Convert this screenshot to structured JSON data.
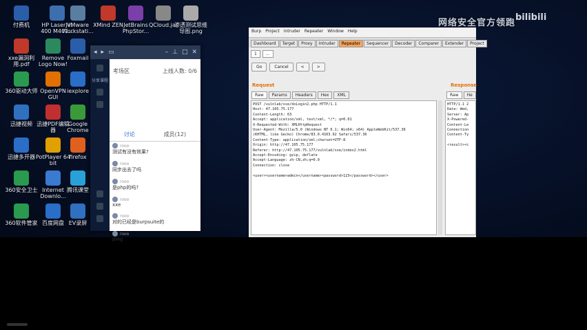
{
  "desktop_icons": [
    {
      "label": "付费机",
      "color": "#2a5ea8"
    },
    {
      "label": "HP LaserJet 400 M401...",
      "color": "#3c6fb0"
    },
    {
      "label": "VMware Workstati...",
      "color": "#5a7ea0"
    },
    {
      "label": "XMind ZEN",
      "color": "#c0392b"
    },
    {
      "label": "JetBrains PhpStor...",
      "color": "#7a3fa8"
    },
    {
      "label": "QCloud.jar",
      "color": "#888888"
    },
    {
      "label": "渗透测试思维导图.png",
      "color": "#aaaaaa"
    },
    {
      "label": "xxe漏洞利用.pdf",
      "color": "#c0392b"
    },
    {
      "label": "Remove Logo Now!",
      "color": "#2a8a5e"
    },
    {
      "label": "Foxmail",
      "color": "#2a5ea8"
    },
    {
      "label": "360驱动大师",
      "color": "#2a9a4e"
    },
    {
      "label": "OpenVPN GUI",
      "color": "#e07000"
    },
    {
      "label": "iexplore",
      "color": "#2a6ec8"
    },
    {
      "label": "迅捷视频",
      "color": "#3070c0"
    },
    {
      "label": "迅捷PDF编辑器",
      "color": "#c03030"
    },
    {
      "label": "Google Chrome",
      "color": "#3a9a3a"
    },
    {
      "label": "迅捷多开器",
      "color": "#2a6ec8"
    },
    {
      "label": "PotPlayer 64 bit",
      "color": "#e0a000"
    },
    {
      "label": "firefox",
      "color": "#e06020"
    },
    {
      "label": "360安全卫士",
      "color": "#2a9a4e"
    },
    {
      "label": "Internet Downlo...",
      "color": "#3a7ad0"
    },
    {
      "label": "腾讯课堂",
      "color": "#2aa0d8"
    },
    {
      "label": "360软件管家",
      "color": "#2a9a4e"
    },
    {
      "label": "百度网盘",
      "color": "#2a6ec8"
    },
    {
      "label": "EV录屏",
      "color": "#3070c0"
    }
  ],
  "watermark": {
    "text": "网络安全官方领跑",
    "logo": "bilibili"
  },
  "chat": {
    "room_title": "考场区",
    "online_count": "上线人数: 0/6",
    "tab_chat": "讨论",
    "tab_members": "成员(12)",
    "side_label": "分享课程",
    "messages": [
      {
        "who": "rooo",
        "text": "测试有没有效果?"
      },
      {
        "who": "rooo",
        "text": "同步出去了吗"
      },
      {
        "who": "rooo",
        "text": "是php的吗?"
      },
      {
        "who": "rooo",
        "text": "xxe"
      },
      {
        "who": "rooo",
        "text": "对的已经是burpsuite的"
      },
      {
        "who": "rooo",
        "text": "ping"
      }
    ]
  },
  "burp": {
    "menu": [
      "Burp",
      "Project",
      "Intruder",
      "Repeater",
      "Window",
      "Help"
    ],
    "tabs": [
      "Dashboard",
      "Target",
      "Proxy",
      "Intruder",
      "Repeater",
      "Sequencer",
      "Decoder",
      "Comparer",
      "Extender",
      "Project"
    ],
    "active_tab": "Repeater",
    "subtab": "1",
    "buttons": [
      "Go",
      "Cancel",
      "<",
      ">"
    ],
    "request_title": "Request",
    "response_title": "Response",
    "req_tabs": [
      "Raw",
      "Params",
      "Headers",
      "Hex",
      "XML"
    ],
    "resp_tabs": [
      "Raw",
      "He"
    ],
    "request_lines": [
      "POST /vulnlab/xxe/doLogin2.php HTTP/1.1",
      "Host: 47.105.75.177",
      "Content-Length: 63",
      "Accept: application/xml, text/xml, */*; q=0.01",
      "X-Requested-With: XMLHttpRequest",
      "User-Agent: Mozilla/5.0 (Windows NT 6.1; Win64; x64) AppleWebKit/537.36",
      "(KHTML, like Gecko) Chrome/83.0.4103.92 Safari/537.36",
      "Content-Type: application/xml;charset=UTF-8",
      "Origin: http://47.105.75.177",
      "Referer: http://47.105.75.177/vulnlab/xxe/index2.html",
      "Accept-Encoding: gzip, deflate",
      "Accept-Language: zh-CN,zh;q=0.9",
      "Connection: close",
      "",
      "<user><username>admin</username><password>123</password></user>"
    ],
    "response_lines": [
      "HTTP/1.1 2",
      "Date: Wed,",
      "Server: Ap",
      "X-Powered-",
      "Content-Le",
      "Connection",
      "Content-Ty",
      "",
      "<result><c"
    ]
  }
}
